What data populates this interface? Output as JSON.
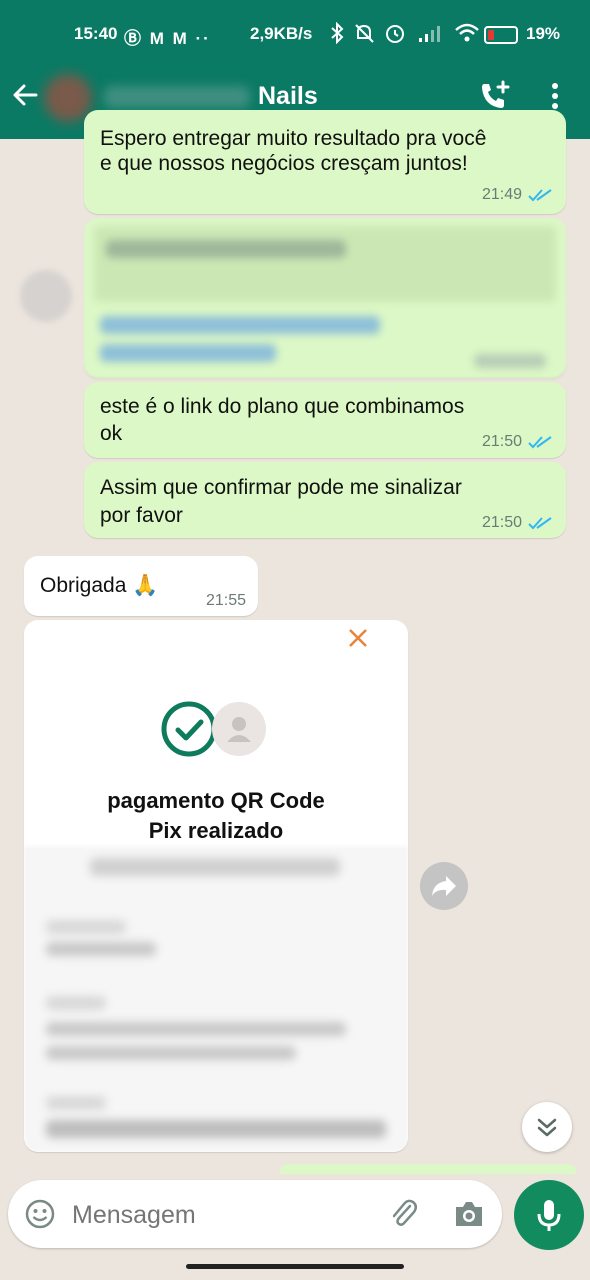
{
  "status_bar": {
    "time": "15:40",
    "status_icons": "Ⓑ M M ··",
    "net_speed": "2,9KB/s",
    "battery_pct": "19%"
  },
  "header": {
    "title": "Nails"
  },
  "messages": [
    {
      "text_lines": [
        "Espero entregar muito resultado pra você",
        "e que nossos negócios cresçam juntos!"
      ],
      "time": "21:49"
    },
    {
      "text_lines": [
        "este é o link do plano que combinamos",
        "ok"
      ],
      "time": "21:50"
    },
    {
      "text_lines": [
        "Assim que confirmar pode me sinalizar",
        "por favor"
      ],
      "time": "21:50"
    },
    {
      "text": "Obrigada 🙏",
      "time": "21:55"
    }
  ],
  "receipt": {
    "title_line1": "pagamento QR Code",
    "title_line2": "Pix realizado"
  },
  "input": {
    "placeholder": "Mensagem"
  },
  "colors": {
    "header": "#0b7a64",
    "outgoing_bubble": "#dcf8c6",
    "accent": "#128c5e",
    "read_ticks": "#34b7f1"
  }
}
